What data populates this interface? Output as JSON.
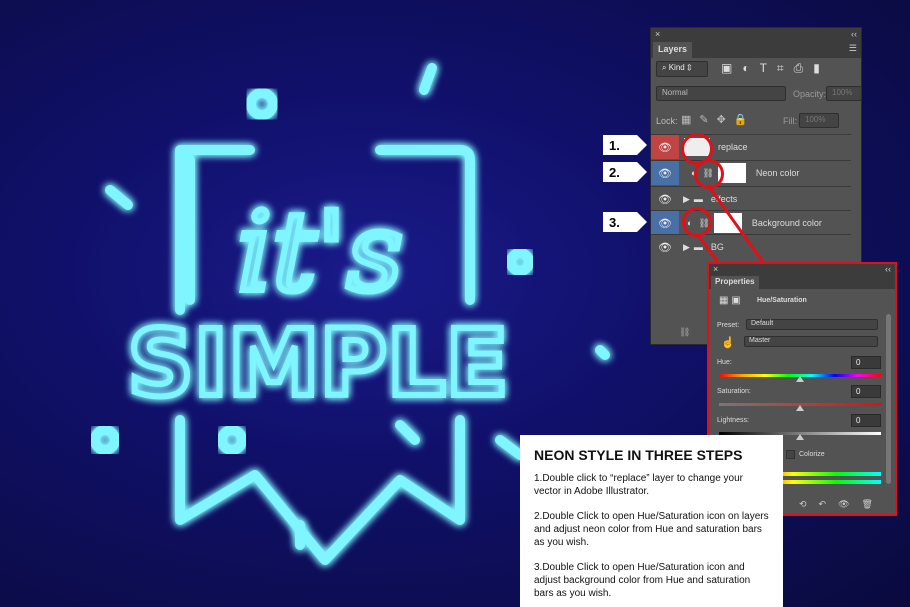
{
  "artwork": {
    "line1": "it's",
    "line2": "SIMPLE",
    "neon_color": "#7ff6ff",
    "bg_color": "#10106a"
  },
  "layers_panel": {
    "close": "×",
    "collapse": "‹‹",
    "tab": "Layers",
    "filter": "Kind",
    "blend_mode": "Normal",
    "opacity_label": "Opacity:",
    "opacity": "100%",
    "lock_label": "Lock:",
    "fill_label": "Fill:",
    "fill": "100%",
    "layers": [
      {
        "name": "replace",
        "type": "smart-object",
        "eye_color": "#c04444"
      },
      {
        "name": "Neon color",
        "type": "adjustment",
        "eye_color": "#4a6fa5"
      },
      {
        "name": "effects",
        "type": "group",
        "eye_color": "#535353"
      },
      {
        "name": "Background color",
        "type": "adjustment",
        "eye_color": "#4a6fa5"
      },
      {
        "name": "BG",
        "type": "group",
        "eye_color": "#535353"
      }
    ]
  },
  "steps_markers": [
    "1.",
    "2.",
    "3."
  ],
  "properties_panel": {
    "close": "×",
    "collapse": "‹‹",
    "tab": "Properties",
    "title": "Hue/Saturation",
    "preset_label": "Preset:",
    "preset": "Default",
    "channel": "Master",
    "hue_label": "Hue:",
    "hue": "0",
    "saturation_label": "Saturation:",
    "saturation": "0",
    "lightness_label": "Lightness:",
    "lightness": "0",
    "colorize_label": "Colorize",
    "accent": "#e0101a"
  },
  "info_box": {
    "title": "NEON STYLE IN THREE STEPS",
    "steps": [
      "1.Double click to “replace” layer to change your vector in Adobe Illustrator.",
      "2.Double Click to open Hue/Saturation icon on layers and adjust neon color from Hue and saturation bars as you wish.",
      "3.Double Click to open Hue/Saturation icon and adjust background color from Hue and saturation bars as you wish."
    ]
  }
}
